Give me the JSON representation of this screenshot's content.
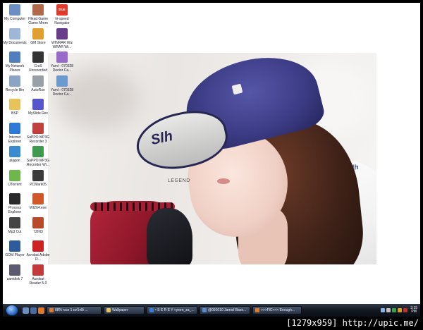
{
  "desktop": {
    "icons_col1": [
      {
        "label": "My Computer",
        "icon": "computer-icon",
        "color": "#6b8fc4"
      },
      {
        "label": "My Documents",
        "icon": "documents-icon",
        "color": "#9db7d9"
      },
      {
        "label": "My Network Places",
        "icon": "network-icon",
        "color": "#4f7fbf"
      },
      {
        "label": "Recycle Bin",
        "icon": "recycle-bin-icon",
        "color": "#8aa4c8"
      },
      {
        "label": "BSP",
        "icon": "folder-icon",
        "color": "#e8c35a"
      },
      {
        "label": "Internet Explorer",
        "icon": "ie-icon",
        "color": "#2f7ad6"
      },
      {
        "label": "plagon",
        "icon": "app-icon",
        "color": "#3a8bd1"
      },
      {
        "label": "UTorrent",
        "icon": "torrent-icon",
        "color": "#6cb84a"
      },
      {
        "label": "Process Explorer",
        "icon": "process-icon",
        "color": "#2a2a2a"
      },
      {
        "label": "Mp3 Cut",
        "icon": "cut-icon",
        "color": "#444444"
      },
      {
        "label": "GOM Player",
        "icon": "player-icon",
        "color": "#2d5b9c"
      },
      {
        "label": "samdisk 7",
        "icon": "disk-icon",
        "color": "#5a5a70"
      }
    ],
    "icons_col2": [
      {
        "label": "Hlead Game Game Mmm",
        "icon": "game-icon",
        "color": "#b06a4a"
      },
      {
        "label": "GM Store",
        "icon": "store-icon",
        "color": "#e0a030"
      },
      {
        "label": "CrsS Unrecorded",
        "icon": "disc-icon",
        "color": "#333333"
      },
      {
        "label": "AutoRun",
        "icon": "autorun-icon",
        "color": "#9aa0aa"
      },
      {
        "label": "MySlide Rec",
        "icon": "slide-icon",
        "color": "#5555cc"
      },
      {
        "label": "SaPPO MP3G Recorder 3",
        "icon": "recorder-icon",
        "color": "#c04040"
      },
      {
        "label": "SaPPO MP3G Recorder Wi...",
        "icon": "recorder2-icon",
        "color": "#3e9a4e"
      },
      {
        "label": "PCMark05",
        "icon": "mark-icon",
        "color": "#3b3b3b"
      },
      {
        "label": "WIZ64.exe",
        "icon": "wiz-icon",
        "color": "#d2582a"
      },
      {
        "label": "7ZIN3",
        "icon": "zip-icon",
        "color": "#b84a2a"
      },
      {
        "label": "Acrobat Adobe R...",
        "icon": "acrobat-icon",
        "color": "#cc2222"
      },
      {
        "label": "Acrobat Reader 5.0",
        "icon": "reader-icon",
        "color": "#c43a3a"
      }
    ],
    "icons_col3": [
      {
        "label": "hi-speed Navigator",
        "icon": "true-icon",
        "color": "#e23a2a",
        "badge": "true"
      },
      {
        "label": "WINRAR Wiz WRAR Wi...",
        "icon": "rar-icon",
        "color": "#6a3b8a"
      },
      {
        "label": "Yaml - 070328 Doctor Ca...",
        "icon": "doc-icon",
        "color": "#9a6ac8"
      },
      {
        "label": "Yaml - 070328 Doctor Ca...",
        "icon": "doc2-icon",
        "color": "#6a9ad0"
      }
    ]
  },
  "wallpaper": {
    "legend_text": "LEGEND",
    "cap_logo": "Slh",
    "shirt_text": "Slh"
  },
  "taskbar": {
    "tasks": [
      {
        "label": "88% ของ 1 ผลไฟล์ ...",
        "icon": "firefox-icon",
        "color": "#e07a2a"
      },
      {
        "label": "Wallpaper",
        "icon": "folder-icon",
        "color": "#e8c35a"
      },
      {
        "label": "• S E R E Y «yeen_za_...",
        "icon": "messenger-icon",
        "color": "#3a7bd5"
      },
      {
        "label": "@091010 Jamsil Base...",
        "icon": "image-icon",
        "color": "#5a8ad0"
      },
      {
        "label": ">>>FiC<<< Enough...",
        "icon": "firefox2-icon",
        "color": "#e07a2a"
      }
    ],
    "clock": {
      "time": "3:15",
      "period": "PM"
    }
  },
  "caption": "[1279x959] http://upic.me/"
}
